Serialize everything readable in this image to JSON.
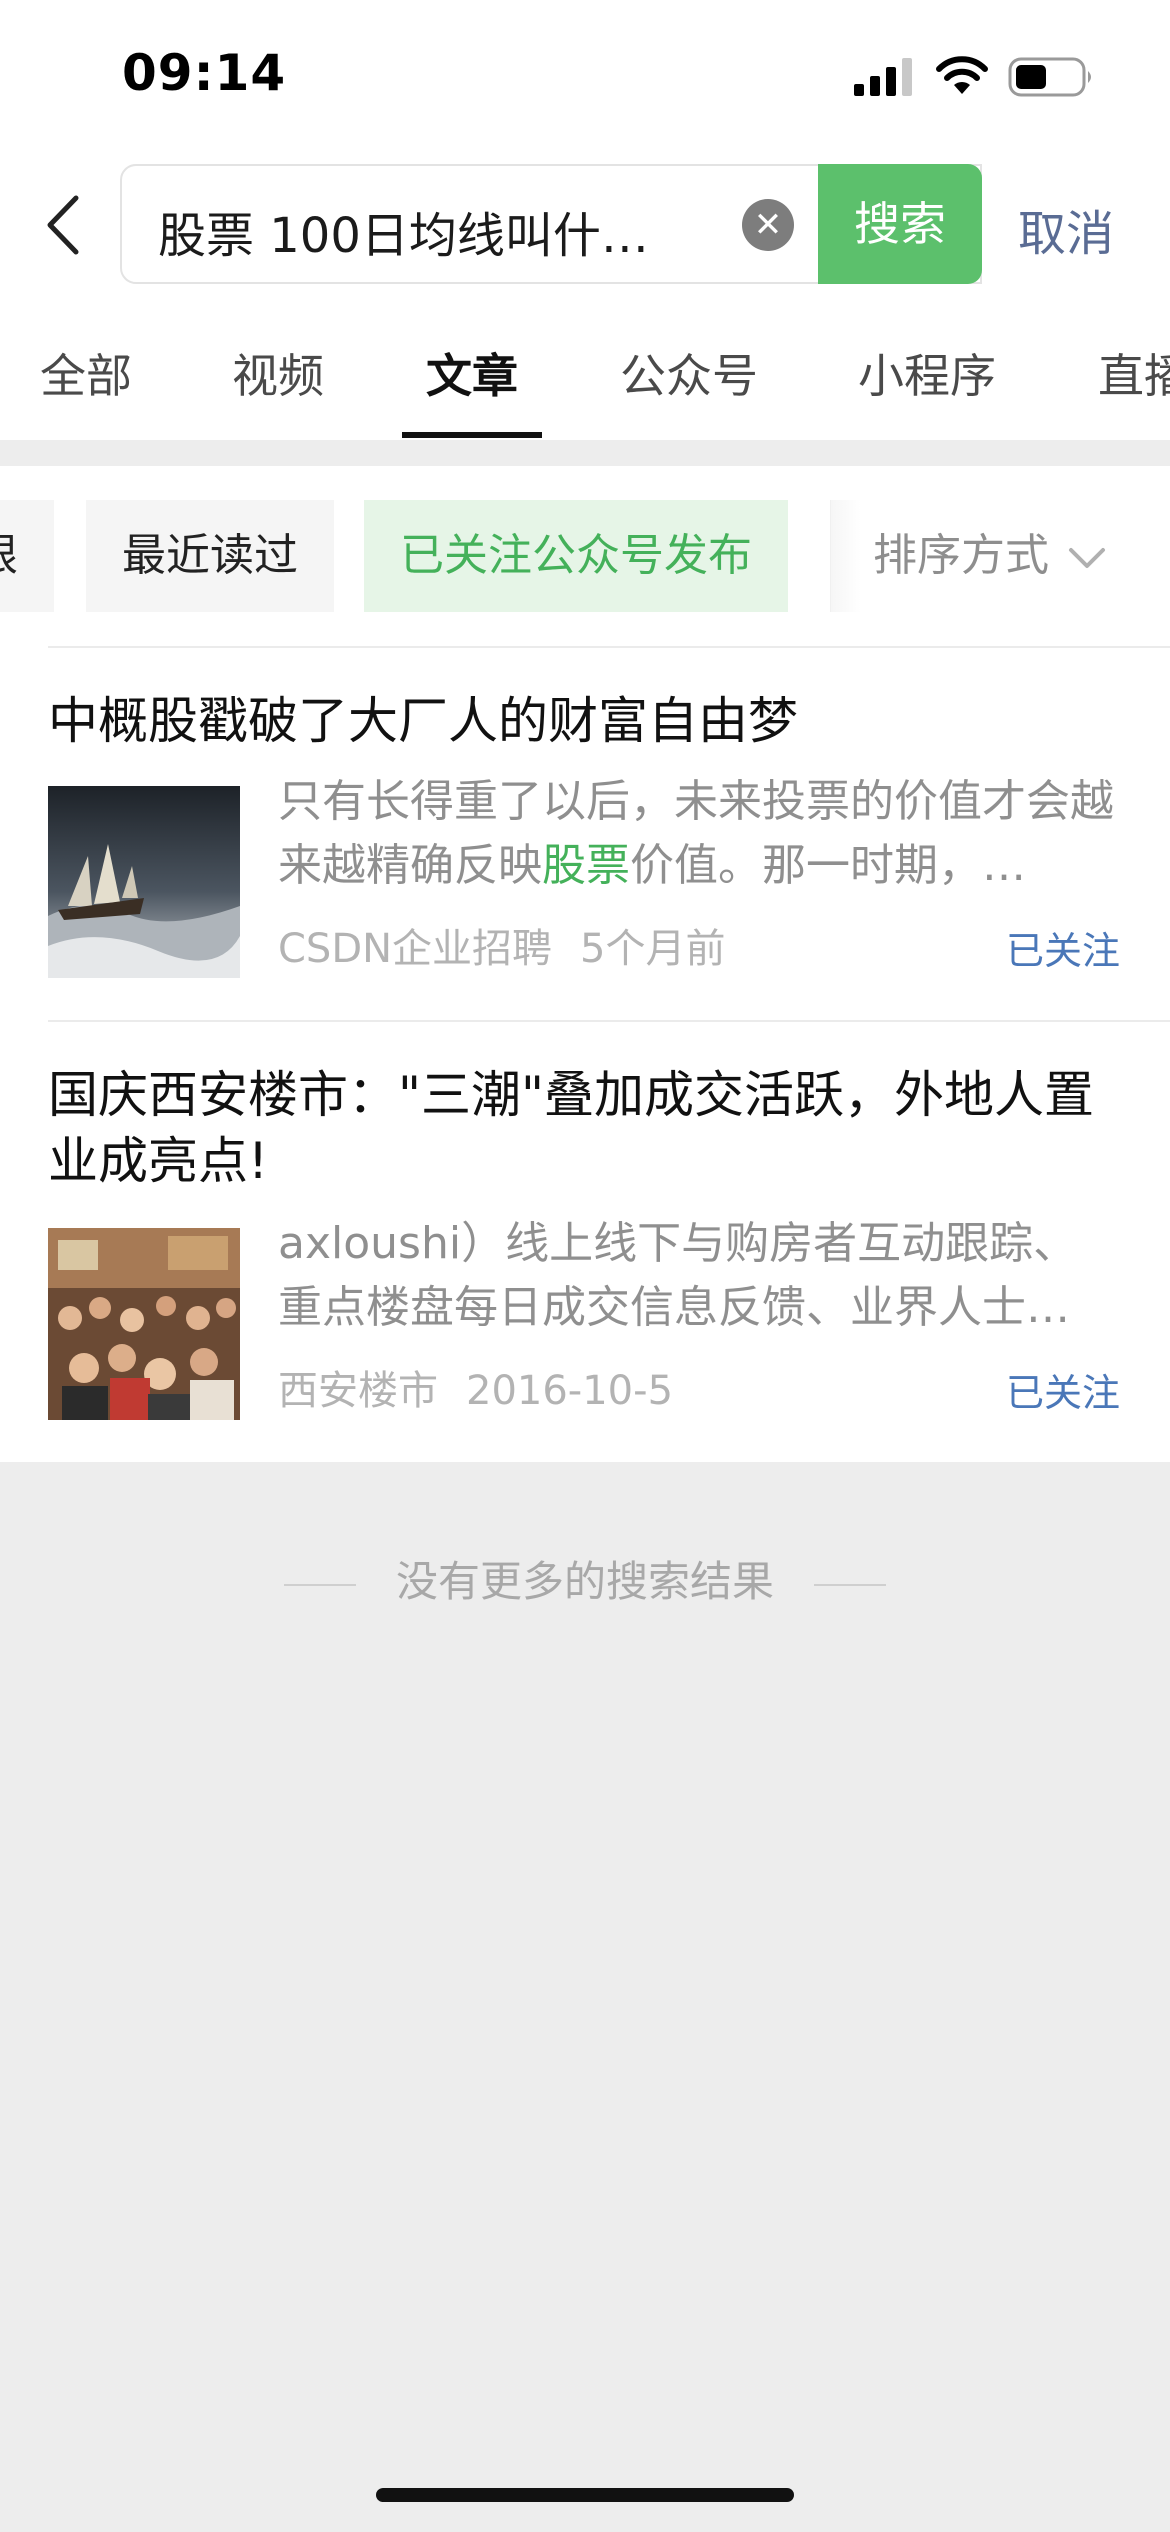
{
  "status_bar": {
    "time": "09:14"
  },
  "search": {
    "query": "股票 100日均线叫什…",
    "search_label": "搜索",
    "cancel_label": "取消"
  },
  "tabs": [
    "全部",
    "视频",
    "文章",
    "公众号",
    "小程序",
    "直播"
  ],
  "active_tab": "文章",
  "filters": {
    "partial_label": "限",
    "recent_label": "最近读过",
    "followed_label": "已关注公众号发布",
    "sort_label": "排序方式"
  },
  "results": [
    {
      "title": "中概股戳破了大厂人的财富自由梦",
      "snippet_before": "只有长得重了以后，未来投票的价值才会越来越精确反映",
      "snippet_highlight": "股票",
      "snippet_after": "价值。那一时期，…",
      "source": "CSDN企业招聘",
      "time": "5个月前",
      "badge": "已关注"
    },
    {
      "title": "国庆西安楼市：\"三潮\"叠加成交活跃，外地人置业成亮点!",
      "snippet": "axloushi）线上线下与购房者互动跟踪、重点楼盘每日成交信息反馈、业界人士…",
      "source": "西安楼市",
      "time": "2016-10-5",
      "badge": "已关注"
    }
  ],
  "footer": {
    "no_more_text": "没有更多的搜索结果"
  },
  "colors": {
    "accent_green": "#5cc06c",
    "link_blue": "#4a77b8",
    "cancel_blue": "#5a6c94"
  },
  "icons": [
    "signal-icon",
    "wifi-icon",
    "battery-icon",
    "back-arrow-icon",
    "clear-icon",
    "chevron-down-icon"
  ]
}
